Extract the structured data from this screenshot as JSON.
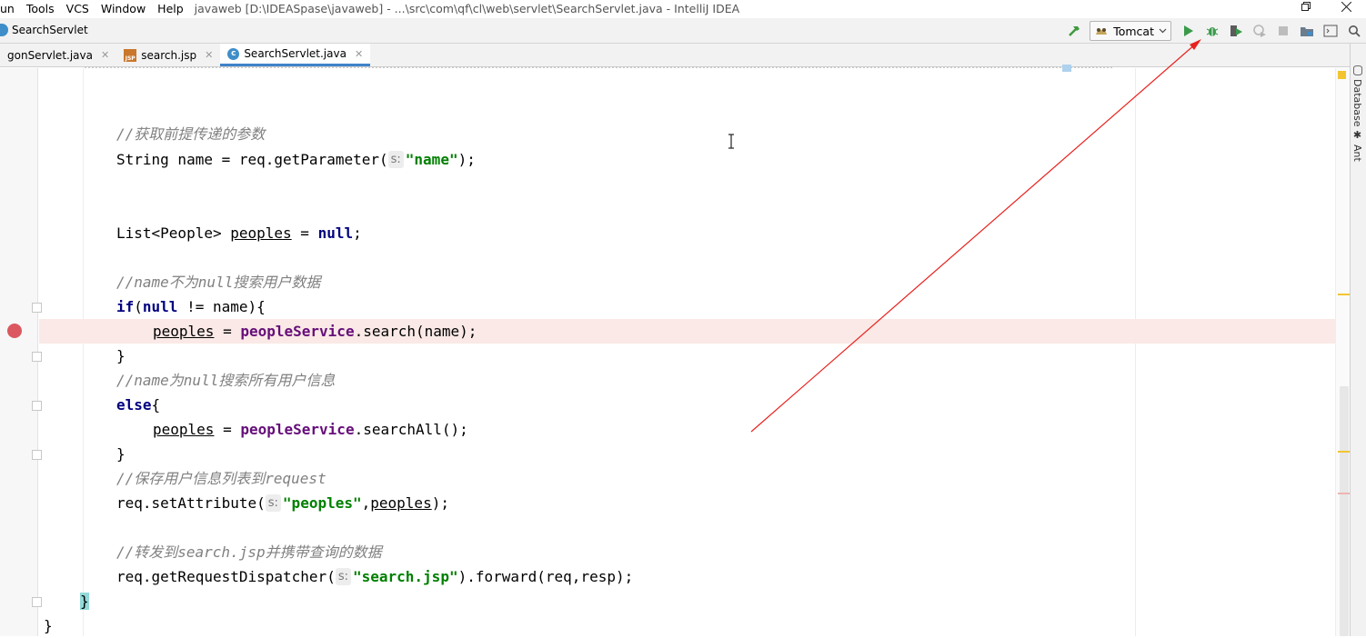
{
  "menu": [
    "un",
    "Tools",
    "VCS",
    "Window",
    "Help"
  ],
  "window_title": "javaweb [D:\\IDEASpase\\javaweb] - ...\\src\\com\\qf\\cl\\web\\servlet\\SearchServlet.java - IntelliJ IDEA",
  "breadcrumb": "SearchServlet",
  "run_config": "Tomcat",
  "tabs": [
    {
      "label": "gonServlet.java",
      "icon": "java-class-icon"
    },
    {
      "label": "search.jsp",
      "icon": "jsp-file-icon"
    },
    {
      "label": "SearchServlet.java",
      "icon": "java-class-icon",
      "active": true
    }
  ],
  "right_tools": [
    "Database",
    "Ant"
  ],
  "code": {
    "comment1": "//获取前提传递的参数",
    "l_name_a": "String name = req.getParameter(",
    "hint_s": "s:",
    "str_name": "\"name\"",
    "l_name_b": ");",
    "l_list_a": "List<People> ",
    "var_peoples": "peoples",
    "l_list_b": " = ",
    "kw_null": "null",
    "semi": ";",
    "comment2": "//name不为null搜索用户数据",
    "kw_if": "if",
    "paren_open": "(",
    "if_rest": " != name){",
    "assign": " = ",
    "field_service": "peopleService",
    "call_search": ".search(name);",
    "close_brace": "}",
    "comment3": "//name为null搜索所有用户信息",
    "kw_else": "else",
    "open_brace": "{",
    "call_search_all": ".searchAll();",
    "comment4": "//保存用户信息列表到request",
    "l_set_a": "req.setAttribute(",
    "str_peoples": "\"peoples\"",
    "comma": ",",
    "l_set_b": ");",
    "comment5": "//转发到search.jsp并携带查询的数据",
    "l_fwd_a": "req.getRequestDispatcher(",
    "str_jsp": "\"search.jsp\"",
    "l_fwd_b": ").forward(req,resp);",
    "method_close": "}",
    "class_close": "}"
  },
  "colors": {
    "annotation_arrow": "#e8221f",
    "breakpoint": "#db5860",
    "highlight_line": "#fae9e6"
  }
}
